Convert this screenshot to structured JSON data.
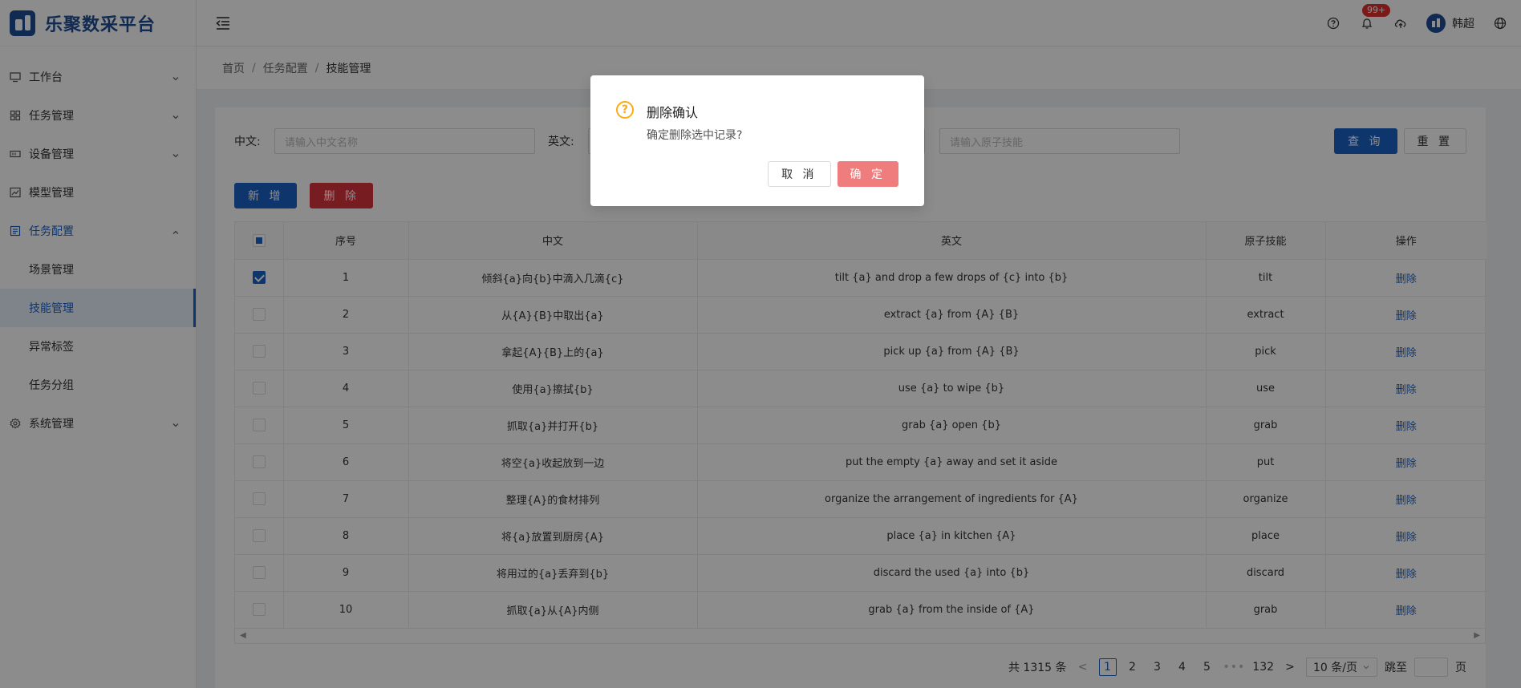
{
  "app": {
    "title": "乐聚数采平台"
  },
  "sidebar": {
    "items": [
      {
        "label": "工作台",
        "icon": "monitor-icon"
      },
      {
        "label": "任务管理",
        "icon": "grid-icon"
      },
      {
        "label": "设备管理",
        "icon": "device-icon"
      },
      {
        "label": "模型管理",
        "icon": "chart-line-icon"
      },
      {
        "label": "任务配置",
        "icon": "config-icon"
      },
      {
        "label": "系统管理",
        "icon": "gear-icon"
      }
    ],
    "submenu": [
      {
        "label": "场景管理"
      },
      {
        "label": "技能管理"
      },
      {
        "label": "异常标签"
      },
      {
        "label": "任务分组"
      }
    ]
  },
  "header": {
    "notification_badge": "99+",
    "user_name": "韩超"
  },
  "breadcrumb": [
    "首页",
    "任务配置",
    "技能管理"
  ],
  "search": {
    "cn_label": "中文:",
    "cn_placeholder": "请输入中文名称",
    "en_label": "英文:",
    "atomic_placeholder": "请输入原子技能",
    "query_label": "查 询",
    "reset_label": "重 置"
  },
  "actions": {
    "add_label": "新 增",
    "delete_label": "删 除"
  },
  "table": {
    "columns": [
      "序号",
      "中文",
      "英文",
      "原子技能",
      "操作"
    ],
    "rows": [
      {
        "no": "1",
        "cn": "倾斜{a}向{b}中滴入几滴{c}",
        "en": "tilt {a} and drop a few drops of {c} into {b}",
        "atomic": "tilt",
        "op": "删除",
        "checked": true
      },
      {
        "no": "2",
        "cn": "从{A}{B}中取出{a}",
        "en": "extract {a} from {A} {B}",
        "atomic": "extract",
        "op": "删除",
        "checked": false
      },
      {
        "no": "3",
        "cn": "拿起{A}{B}上的{a}",
        "en": "pick up {a} from {A} {B}",
        "atomic": "pick",
        "op": "删除",
        "checked": false
      },
      {
        "no": "4",
        "cn": "使用{a}擦拭{b}",
        "en": "use {a} to wipe {b}",
        "atomic": "use",
        "op": "删除",
        "checked": false
      },
      {
        "no": "5",
        "cn": "抓取{a}并打开{b}",
        "en": "grab {a} open {b}",
        "atomic": "grab",
        "op": "删除",
        "checked": false
      },
      {
        "no": "6",
        "cn": "将空{a}收起放到一边",
        "en": "put the empty {a} away and set it aside",
        "atomic": "put",
        "op": "删除",
        "checked": false
      },
      {
        "no": "7",
        "cn": "整理{A}的食材排列",
        "en": "organize the arrangement of ingredients for {A}",
        "atomic": "organize",
        "op": "删除",
        "checked": false
      },
      {
        "no": "8",
        "cn": "将{a}放置到厨房{A}",
        "en": "place {a} in kitchen {A}",
        "atomic": "place",
        "op": "删除",
        "checked": false
      },
      {
        "no": "9",
        "cn": "将用过的{a}丢弃到{b}",
        "en": "discard the used {a} into {b}",
        "atomic": "discard",
        "op": "删除",
        "checked": false
      },
      {
        "no": "10",
        "cn": "抓取{a}从{A}内侧",
        "en": "grab {a} from the inside of {A}",
        "atomic": "grab",
        "op": "删除",
        "checked": false
      }
    ]
  },
  "pagination": {
    "total_text": "共 1315 条",
    "pages": [
      "1",
      "2",
      "3",
      "4",
      "5"
    ],
    "ellipsis": "•••",
    "last_page": "132",
    "page_size": "10 条/页",
    "jump_label": "跳至",
    "page_suffix": "页"
  },
  "dialog": {
    "title": "删除确认",
    "content": "确定删除选中记录?",
    "cancel_label": "取 消",
    "ok_label": "确 定"
  },
  "colors": {
    "primary": "#1d62c7",
    "danger": "#d9363e",
    "warning": "#faad14"
  }
}
